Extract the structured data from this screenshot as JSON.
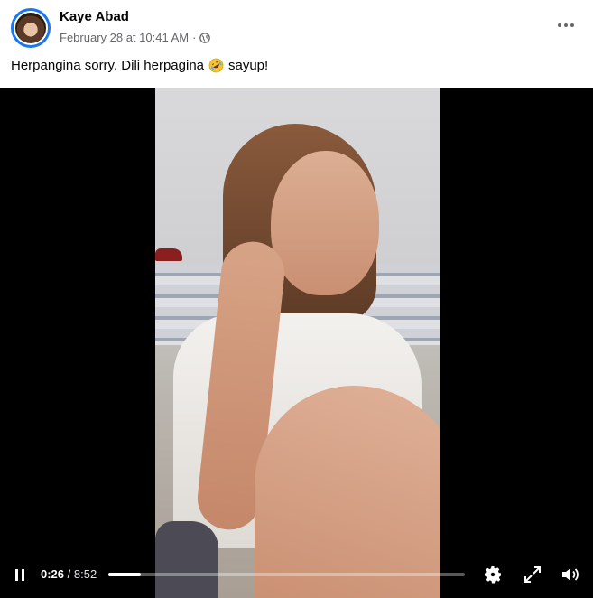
{
  "post": {
    "author": "Kaye Abad",
    "timestamp": "February 28 at 10:41 AM",
    "separator": "·",
    "audience_icon": "globe-icon",
    "caption_part1": "Herpangina sorry. Dili herpagina",
    "caption_emoji": "rolling-on-floor-laughing-emoji",
    "caption_part2": "sayup!"
  },
  "video": {
    "current_time": "0:26",
    "time_separator": "/",
    "duration": "8:52",
    "progress_fraction": 0.09
  },
  "colors": {
    "link_blue": "#1877f2",
    "meta_gray": "#65676b",
    "video_bg": "#000000"
  }
}
